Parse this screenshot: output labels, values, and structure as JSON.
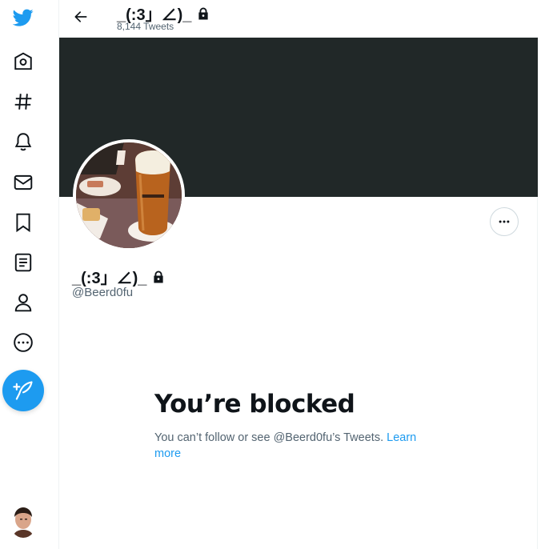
{
  "profile": {
    "display_name": "_(:3」∠)_",
    "tweet_count": "8,144 Tweets",
    "handle": "@Beerd0fu"
  },
  "blocked": {
    "title": "You’re blocked",
    "message": "You can’t follow or see @Beerd0fu’s Tweets. ",
    "learn_more": "Learn more"
  },
  "icons": {
    "logo": "twitter-bird-icon",
    "nav": [
      "home-icon",
      "explore-hashtag-icon",
      "notifications-bell-icon",
      "messages-envelope-icon",
      "bookmark-icon",
      "lists-icon",
      "profile-person-icon",
      "more-circle-icon"
    ],
    "compose": "compose-feather-icon",
    "back": "back-arrow-icon",
    "lock": "lock-icon",
    "more": "more-horizontal-icon"
  },
  "colors": {
    "accent": "#1d9bf0",
    "banner": "#212828",
    "text": "#0f1419",
    "muted": "#536471"
  }
}
